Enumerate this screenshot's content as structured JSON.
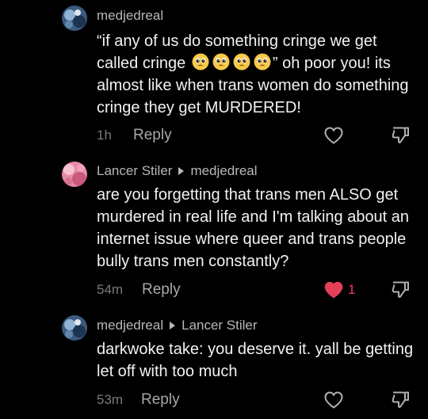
{
  "colors": {
    "background": "#000000",
    "text": "#f2f2f2",
    "meta": "#b8b8b8",
    "muted": "#7a7a7a",
    "like_active": "#e4405a"
  },
  "comments": [
    {
      "author": "medjedreal",
      "reply_to": "",
      "text_before": "“if any of us do something cringe we get called cringe",
      "emojis": [
        "pleading-face",
        "pleading-face",
        "pleading-face",
        "pleading-face"
      ],
      "text_after": "” oh poor you! its almost like when trans women do something cringe they get MURDERED!",
      "time": "1h",
      "reply_label": "Reply",
      "likes": "",
      "liked": false
    },
    {
      "author": "Lancer Stiler",
      "reply_to": "medjedreal",
      "text": "are you forgetting that trans men ALSO get murdered in real life and I'm talking about an internet issue where queer and trans people bully trans men constantly?",
      "time": "54m",
      "reply_label": "Reply",
      "likes": "1",
      "liked": true
    },
    {
      "author": "medjedreal",
      "reply_to": "Lancer Stiler",
      "text": "darkwoke take: you deserve it. yall be getting let off with too much",
      "time": "53m",
      "reply_label": "Reply",
      "likes": "",
      "liked": false
    }
  ]
}
